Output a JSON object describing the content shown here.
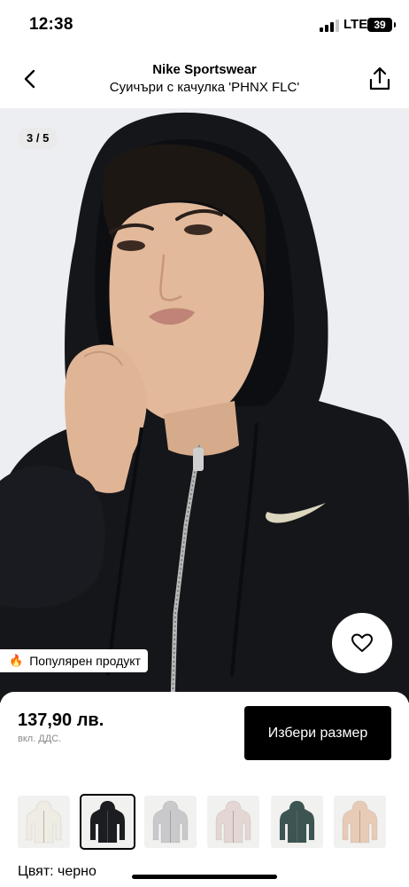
{
  "status_bar": {
    "time": "12:38",
    "network": "LTE",
    "battery": "39"
  },
  "header": {
    "brand": "Nike Sportswear",
    "title": "Суичъри с качулка 'PHNX FLC'",
    "back_icon": "chevron-left-icon",
    "share_icon": "share-icon"
  },
  "gallery": {
    "indicator": "3 / 5",
    "badge_icon": "fire-icon",
    "badge_text": "Популярен продукт",
    "wishlist_icon": "heart-icon"
  },
  "product": {
    "price": "137,90 лв.",
    "vat_note": "вкл. ДДС.",
    "size_button": "Избери размер",
    "color_label": "Цвят: черно"
  },
  "colors": {
    "swatches": [
      {
        "name": "cream",
        "hex": "#efece4",
        "bg": "#f1f1f0"
      },
      {
        "name": "black",
        "hex": "#1c1d21",
        "bg": "#f1f1f0",
        "selected": true
      },
      {
        "name": "grey",
        "hex": "#c9c9cb",
        "bg": "#f1f1f0"
      },
      {
        "name": "light-pink",
        "hex": "#e3d6d3",
        "bg": "#f1f1f0"
      },
      {
        "name": "dark-green",
        "hex": "#3d5552",
        "bg": "#f1f1f0"
      },
      {
        "name": "beige",
        "hex": "#e8cbb6",
        "bg": "#f1f1f0"
      }
    ]
  }
}
